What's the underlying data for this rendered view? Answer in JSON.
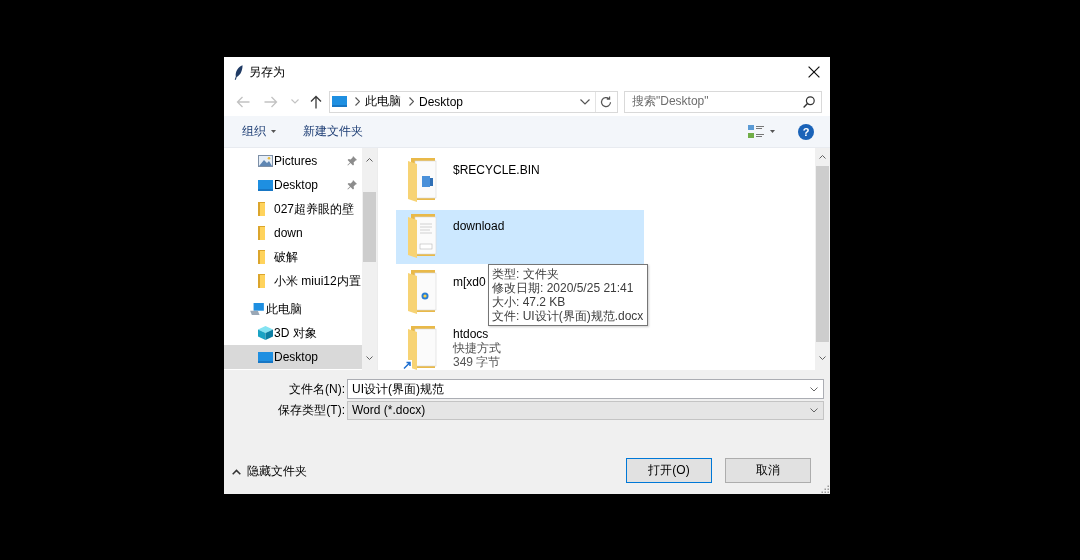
{
  "window": {
    "title": "另存为"
  },
  "nav_buttons": [
    {
      "kind": "back",
      "disabled": true
    },
    {
      "kind": "forward",
      "disabled": true
    },
    {
      "kind": "recent",
      "disabled": true
    },
    {
      "kind": "up",
      "disabled": false
    }
  ],
  "address_bar": {
    "crumbs": [
      "此电脑",
      "Desktop"
    ]
  },
  "search": {
    "placeholder": "搜索\"Desktop\""
  },
  "toolbar": {
    "organize": "组织",
    "new_folder": "新建文件夹",
    "help": "?"
  },
  "nav_pane": {
    "quick_access": [
      {
        "label": "Pictures",
        "kind": "pictures",
        "pinned": true,
        "selected": false
      },
      {
        "label": "Desktop",
        "kind": "desktop",
        "pinned": true,
        "selected": false
      },
      {
        "label": "027超养眼的壁",
        "kind": "folder",
        "pinned": false,
        "selected": false
      },
      {
        "label": "down",
        "kind": "folder",
        "pinned": false,
        "selected": false
      },
      {
        "label": "破解",
        "kind": "folder",
        "pinned": false,
        "selected": false
      },
      {
        "label": "小米 miui12内置",
        "kind": "folder",
        "pinned": false,
        "selected": false
      }
    ],
    "this_pc": {
      "label": "此电脑",
      "kind": "computer",
      "selected": false,
      "children": [
        {
          "label": "3D 对象",
          "kind": "objects3d",
          "selected": false
        },
        {
          "label": "Desktop",
          "kind": "desktop",
          "selected": true
        }
      ]
    }
  },
  "file_list": {
    "items": [
      {
        "name": "$RECYCLE.BIN",
        "kind": "recycle_folder",
        "selected": false
      },
      {
        "name": "download",
        "kind": "docx_folder",
        "selected": true
      },
      {
        "name": "m[xd0",
        "kind": "web_folder",
        "selected": false
      },
      {
        "name": "htdocs",
        "kind": "shortcut",
        "selected": false,
        "details": [
          "快捷方式",
          "349 字节"
        ]
      }
    ]
  },
  "tooltip": {
    "lines": [
      "类型: 文件夹",
      "修改日期: 2020/5/25 21:41",
      "大小: 47.2 KB",
      "文件: UI设计(界面)规范.docx"
    ]
  },
  "form": {
    "file_name": {
      "label": "文件名(N):",
      "value": "UI设计(界面)规范"
    },
    "file_type": {
      "label": "保存类型(T):",
      "value": "Word (*.docx)"
    }
  },
  "hide_folders": {
    "label": "隐藏文件夹"
  },
  "buttons": [
    {
      "label": "打开(O)",
      "default": true
    },
    {
      "label": "取消",
      "default": false
    }
  ]
}
